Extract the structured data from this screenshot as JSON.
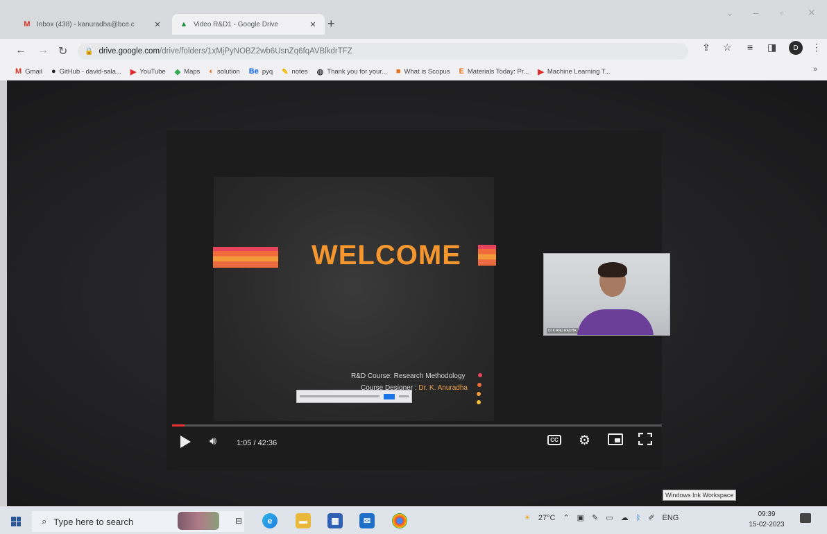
{
  "browser": {
    "tabs": [
      {
        "label": "Inbox (438) - kanuradha@bce.c",
        "favicon": "gmail-icon",
        "color": "#d93025"
      },
      {
        "label": "Video R&D1 - Google Drive",
        "favicon": "google-drive-icon",
        "color": "#1e8e3e"
      }
    ],
    "url_host": "drive.google.com",
    "url_path": "/drive/folders/1xMjPyNOBZ2wb6UsnZq6fqAVBlkdrTFZ",
    "profile_initial": "D",
    "bookmarks": [
      {
        "label": "Gmail",
        "icon": "gmail-icon",
        "color": "#d93025"
      },
      {
        "label": "GitHub - david-sala...",
        "icon": "github-icon",
        "color": "#222222"
      },
      {
        "label": "YouTube",
        "icon": "youtube-icon",
        "color": "#e02828"
      },
      {
        "label": "Maps",
        "icon": "maps-icon",
        "color": "#34a853"
      },
      {
        "label": "solution",
        "icon": "solution-icon",
        "color": "#e8711a"
      },
      {
        "label": "pyq",
        "icon": "behance-icon",
        "color": "#0b5ff0",
        "prefix": "Be"
      },
      {
        "label": "notes",
        "icon": "notes-icon",
        "color": "#f2b300"
      },
      {
        "label": "Thank you for your...",
        "icon": "globe-icon",
        "color": "#444444"
      },
      {
        "label": "What is Scopus",
        "icon": "scopus-icon",
        "color": "#e8711a"
      },
      {
        "label": "Materials Today: Pr...",
        "icon": "elsevier-icon",
        "color": "#e8711a",
        "prefix": "E"
      },
      {
        "label": "Machine Learning T...",
        "icon": "youtube-icon",
        "color": "#e02828"
      }
    ]
  },
  "slide": {
    "title": "WELCOME",
    "course_line": "R&D Course: Research Methodology",
    "designer_label": "Course Designer : ",
    "designer_name": "Dr. K. Anuradha"
  },
  "webcam": {
    "name_tag": "Dr K ANU RADHA"
  },
  "player": {
    "timecode": "1:05 / 42:36",
    "progress": 0.025
  },
  "tooltip": "Windows Ink Workspace",
  "taskbar": {
    "search_placeholder": "Type here to search",
    "weather": "27°C",
    "language": "ENG",
    "time": "09:39",
    "date": "15-02-2023"
  }
}
